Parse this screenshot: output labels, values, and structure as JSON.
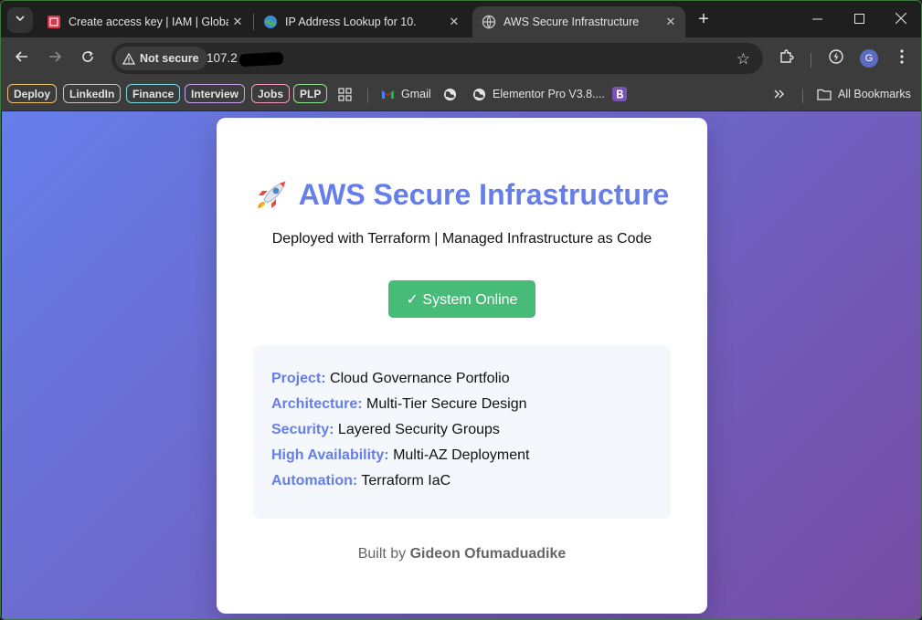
{
  "browser": {
    "tabs": [
      {
        "title": "Create access key | IAM | Global",
        "active": false
      },
      {
        "title": "IP Address Lookup for 10.",
        "active": false
      },
      {
        "title": "AWS Secure Infrastructure",
        "active": true
      }
    ],
    "security_chip": "Not secure",
    "url": "107.2",
    "profile_initial": "G"
  },
  "bookmarks": {
    "tags": [
      {
        "label": "Deploy",
        "color": "#f0c36d"
      },
      {
        "label": "LinkedIn",
        "color": "#c4c4c4"
      },
      {
        "label": "Finance",
        "color": "#7fd6e3"
      },
      {
        "label": "Interview",
        "color": "#c9a0f0"
      },
      {
        "label": "Jobs",
        "color": "#f49ac2"
      },
      {
        "label": "PLP",
        "color": "#8fe38f"
      }
    ],
    "gmail": "Gmail",
    "elementor": "Elementor Pro V3.8....",
    "all": "All Bookmarks"
  },
  "page": {
    "title": "AWS Secure Infrastructure",
    "subtitle": "Deployed with Terraform | Managed Infrastructure as Code",
    "status": "✓ System Online",
    "info": [
      {
        "key": "Project:",
        "value": "Cloud Governance Portfolio"
      },
      {
        "key": "Architecture:",
        "value": "Multi-Tier Secure Design"
      },
      {
        "key": "Security:",
        "value": "Layered Security Groups"
      },
      {
        "key": "High Availability:",
        "value": "Multi-AZ Deployment"
      },
      {
        "key": "Automation:",
        "value": "Terraform IaC"
      }
    ],
    "footer_prefix": "Built by",
    "footer_name": "Gideon Ofumaduadike"
  },
  "colors": {
    "accent": "#667eea",
    "gradient_end": "#764ba2",
    "status_green": "#48bb78"
  },
  "icons": {
    "title": "rocket-icon"
  }
}
